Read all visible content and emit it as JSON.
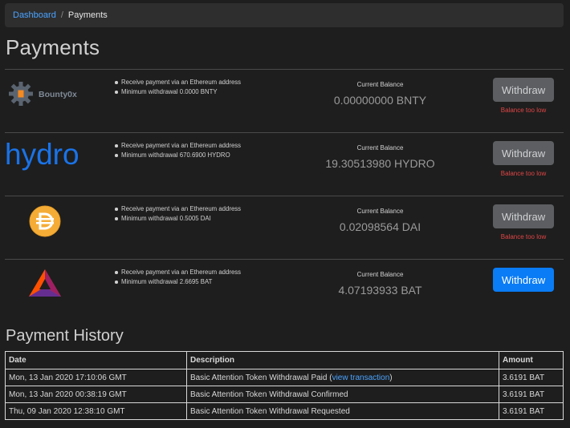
{
  "breadcrumb": {
    "home": "Dashboard",
    "separator": "/",
    "current": "Payments"
  },
  "page_title": "Payments",
  "colors": {
    "accent": "#0a7cf5",
    "error": "#e04545",
    "disabled": "#5c5e61"
  },
  "payments": [
    {
      "token": "BNTY",
      "logo_text": "Bounty0x",
      "bullets": [
        "Receive payment via an Ethereum address",
        "Minimum withdrawal 0.0000 BNTY"
      ],
      "balance_label": "Current Balance",
      "balance": "0.00000000 BNTY",
      "button": "Withdraw",
      "enabled": false,
      "error": "Balance too low"
    },
    {
      "token": "HYDRO",
      "logo_text": "hydro",
      "bullets": [
        "Receive payment via an Ethereum address",
        "Minimum withdrawal 670.6900 HYDRO"
      ],
      "balance_label": "Current Balance",
      "balance": "19.30513980 HYDRO",
      "button": "Withdraw",
      "enabled": false,
      "error": "Balance too low"
    },
    {
      "token": "DAI",
      "bullets": [
        "Receive payment via an Ethereum address",
        "Minimum withdrawal 0.5005 DAI"
      ],
      "balance_label": "Current Balance",
      "balance": "0.02098564 DAI",
      "button": "Withdraw",
      "enabled": false,
      "error": "Balance too low"
    },
    {
      "token": "BAT",
      "bullets": [
        "Receive payment via an Ethereum address",
        "Minimum withdrawal 2.6695 BAT"
      ],
      "balance_label": "Current Balance",
      "balance": "4.07193933 BAT",
      "button": "Withdraw",
      "enabled": true,
      "error": ""
    }
  ],
  "history": {
    "title": "Payment History",
    "columns": [
      "Date",
      "Description",
      "Amount"
    ],
    "rows": [
      {
        "date": "Mon, 13 Jan 2020 17:10:06 GMT",
        "description": "Basic Attention Token Withdrawal Paid (",
        "link": "view transaction",
        "description_end": ")",
        "amount": "3.6191 BAT"
      },
      {
        "date": "Mon, 13 Jan 2020 00:38:19 GMT",
        "description": "Basic Attention Token Withdrawal Confirmed",
        "link": "",
        "description_end": "",
        "amount": "3.6191 BAT"
      },
      {
        "date": "Thu, 09 Jan 2020 12:38:10 GMT",
        "description": "Basic Attention Token Withdrawal Requested",
        "link": "",
        "description_end": "",
        "amount": "3.6191 BAT"
      }
    ]
  }
}
